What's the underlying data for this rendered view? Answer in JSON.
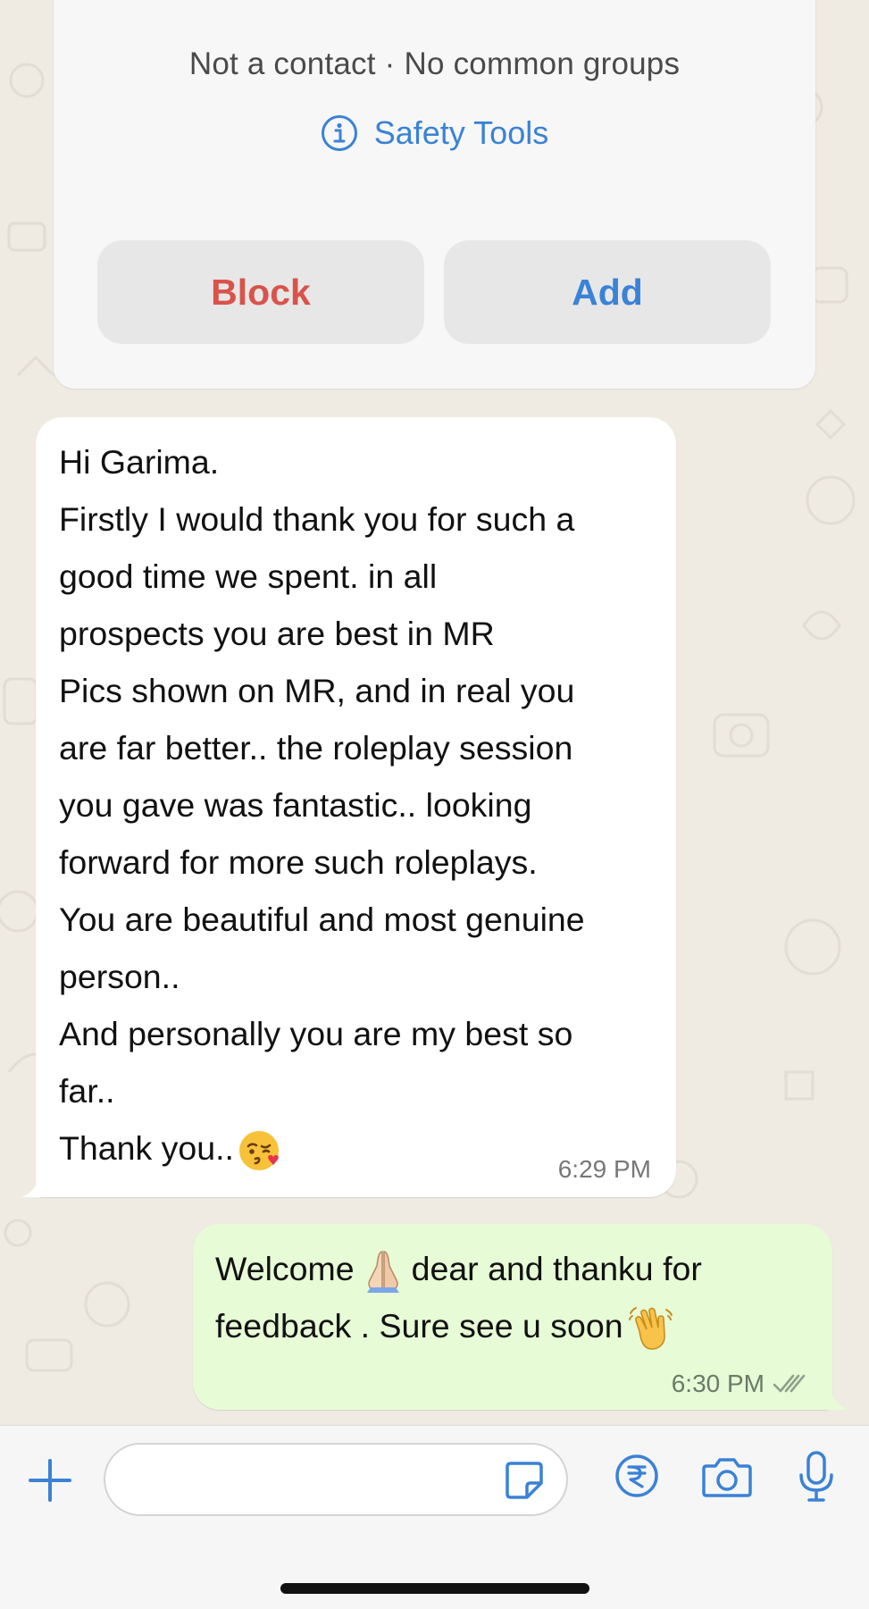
{
  "contact_card": {
    "status_not_contact": "Not a contact",
    "separator": "·",
    "status_groups": "No common groups",
    "safety_tools_label": "Safety Tools",
    "block_label": "Block",
    "add_label": "Add"
  },
  "messages": [
    {
      "direction": "incoming",
      "lines": [
        "Hi Garima.",
        "Firstly I would thank you for such a",
        "good time we spent. in all",
        "prospects you are best in MR",
        "Pics shown on MR, and in real you",
        "are far better.. the roleplay session",
        "you gave was fantastic.. looking",
        "forward for more such roleplays.",
        "You are beautiful and most genuine",
        "person..",
        "And personally you are my best so",
        "far..",
        "Thank you.."
      ],
      "trailing_emoji": "kissing-face-with-heart-emoji",
      "time": "6:29 PM"
    },
    {
      "direction": "outgoing",
      "line1_before": "Welcome",
      "line1_emoji": "folded-hands-emoji",
      "line1_after": "dear and thanku for",
      "line2_before": "feedback . Sure see u soon",
      "line2_emoji": "waving-hand-emoji",
      "time": "6:30 PM",
      "status": "read-double-check-icon"
    }
  ],
  "input_bar": {
    "plus_icon": "plus-icon",
    "text_value": "",
    "sticker_icon": "sticker-icon",
    "payment_icon": "rupee-payment-icon",
    "camera_icon": "camera-icon",
    "mic_icon": "microphone-icon"
  },
  "colors": {
    "accent_blue": "#3a82d6",
    "block_red": "#d9534a",
    "outgoing_bubble": "#e6fbd6",
    "incoming_bubble": "#ffffff",
    "chat_background": "#efeae2"
  }
}
